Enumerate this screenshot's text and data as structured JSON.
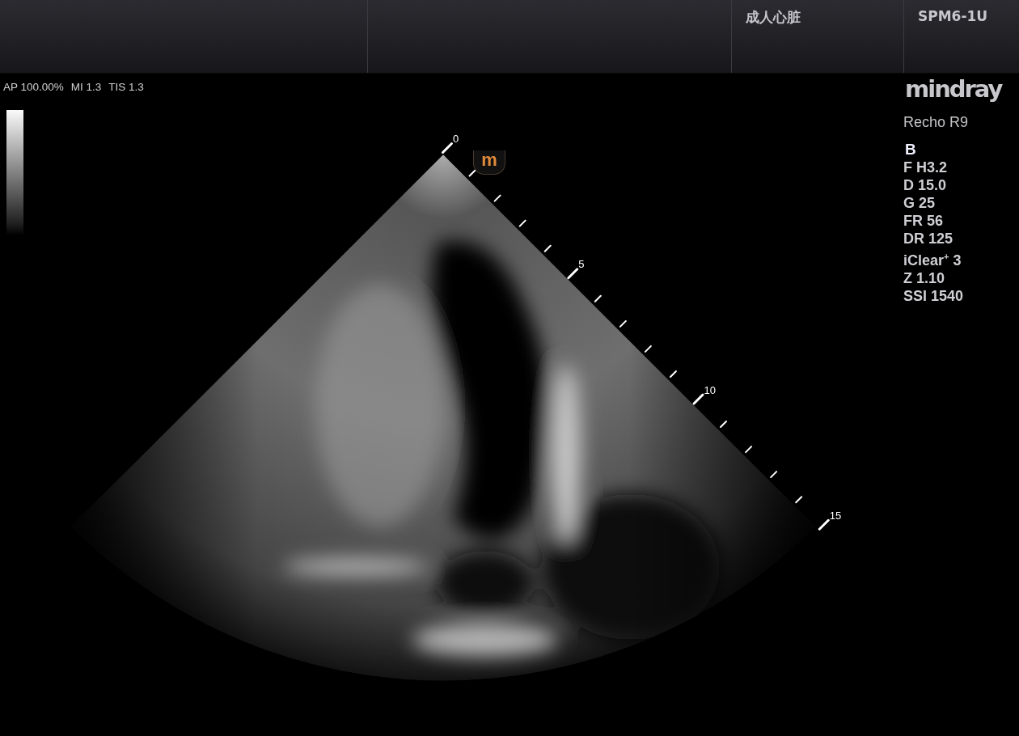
{
  "header": {
    "exam_preset": "成人心脏",
    "probe": "SPM6-1U"
  },
  "acoustic_output": [
    "AP 100.00%",
    "MI 1.3",
    "TIS 1.3"
  ],
  "brand": {
    "logo": "mindray",
    "model": "Recho R9"
  },
  "mode": "B",
  "parameters": [
    "F H3.2",
    "D 15.0",
    "G 25",
    "FR 56",
    "DR 125",
    "iClear$^{+}$ 3",
    "Z 1.10",
    "SSI 1540"
  ],
  "orientation_marker": "m",
  "depth_scale": {
    "labels": [
      "0",
      "5",
      "10",
      "15"
    ]
  }
}
